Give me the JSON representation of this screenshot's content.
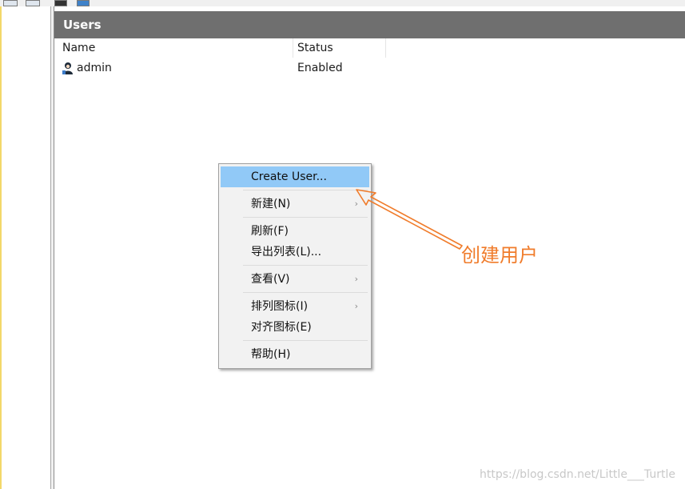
{
  "pane": {
    "title": "Users"
  },
  "columns": {
    "name": "Name",
    "status": "Status"
  },
  "rows": [
    {
      "name": "admin",
      "status": "Enabled",
      "icon": "user-icon"
    }
  ],
  "menu": {
    "items": [
      {
        "label": "Create User...",
        "highlighted": true,
        "submenu": false
      },
      {
        "label": "新建(N)",
        "submenu": true
      },
      {
        "label": "刷新(F)",
        "submenu": false
      },
      {
        "label": "导出列表(L)...",
        "submenu": false
      },
      {
        "label": "查看(V)",
        "submenu": true
      },
      {
        "label": "排列图标(I)",
        "submenu": true
      },
      {
        "label": "对齐图标(E)",
        "submenu": false
      },
      {
        "label": "帮助(H)",
        "submenu": false
      }
    ],
    "submenu_arrow": "›"
  },
  "annotation": {
    "text": "创建用户",
    "color": "#f07c2b"
  },
  "watermark": "https://blog.csdn.net/Little___Turtle",
  "colors": {
    "title_bar": "#6f6f6f",
    "highlight": "#91c9f7"
  }
}
